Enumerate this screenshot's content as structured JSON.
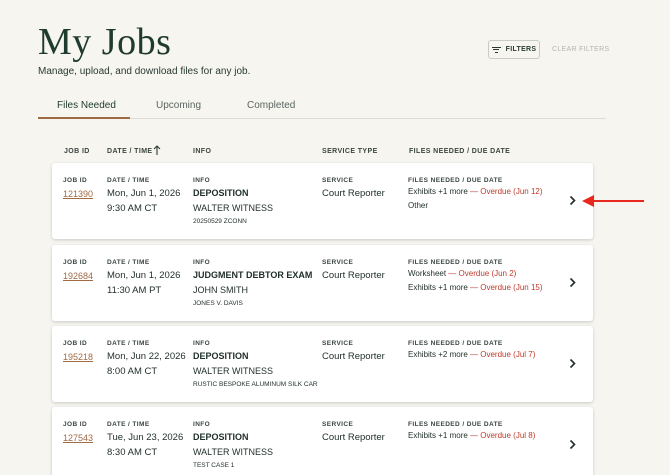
{
  "page": {
    "title": "My Jobs",
    "subtitle": "Manage, upload, and download files for any job."
  },
  "toolbar": {
    "filters_label": "FILTERS",
    "clear_filters_label": "CLEAR FILTERS"
  },
  "tabs": [
    {
      "label": "Files Needed",
      "active": true
    },
    {
      "label": "Upcoming",
      "active": false
    },
    {
      "label": "Completed",
      "active": false
    }
  ],
  "columns": {
    "job_id": "JOB ID",
    "date_time": "DATE / TIME",
    "info": "INFO",
    "service_type": "SERVICE TYPE",
    "files_due": "FILES NEEDED / DUE DATE"
  },
  "card_labels": {
    "job_id": "JOB ID",
    "date_time": "DATE / TIME",
    "info": "INFO",
    "service": "SERVICE",
    "files_due": "FILES NEEDED / DUE DATE"
  },
  "jobs": [
    {
      "id": "121390",
      "date": "Mon, Jun 1, 2026",
      "time": "9:30 AM CT",
      "title": "DEPOSITION",
      "witness": "WALTER WITNESS",
      "case": "20250529 ZCONN",
      "service": "Court Reporter",
      "files": [
        {
          "text": "Exhibits +1 more",
          "overdue": " — Overdue (Jun 12)"
        },
        {
          "text": "Other",
          "overdue": ""
        }
      ]
    },
    {
      "id": "192684",
      "date": "Mon, Jun 1, 2026",
      "time": "11:30 AM PT",
      "title": "JUDGMENT DEBTOR EXAM",
      "witness": "JOHN SMITH",
      "case": "JONES V. DAVIS",
      "service": "Court Reporter",
      "files": [
        {
          "text": "Worksheet",
          "overdue": " — Overdue (Jun 2)"
        },
        {
          "text": "Exhibits +1 more",
          "overdue": " — Overdue (Jun 15)"
        }
      ]
    },
    {
      "id": "195218",
      "date": "Mon, Jun 22, 2026",
      "time": "8:00 AM CT",
      "title": "DEPOSITION",
      "witness": "WALTER WITNESS",
      "case": "RUSTIC BESPOKE ALUMINUM SILK CAR",
      "service": "Court Reporter",
      "files": [
        {
          "text": "Exhibits +2 more",
          "overdue": " — Overdue (Jul 7)"
        }
      ]
    },
    {
      "id": "127543",
      "date": "Tue, Jun 23, 2026",
      "time": "8:30 AM CT",
      "title": "DEPOSITION",
      "witness": "WALTER WITNESS",
      "case": "TEST CASE 1",
      "service": "Court Reporter",
      "files": [
        {
          "text": "Exhibits +1 more",
          "overdue": " — Overdue (Jul 8)"
        }
      ]
    }
  ],
  "colors": {
    "background": "#f6f5f0",
    "accent": "#a06a45",
    "overdue": "#c0392b",
    "annotation_arrow": "#e8281e"
  },
  "icons": [
    "filter-icon",
    "sort-up-arrow-icon",
    "chevron-right-icon",
    "red-pointer-arrow-icon"
  ]
}
